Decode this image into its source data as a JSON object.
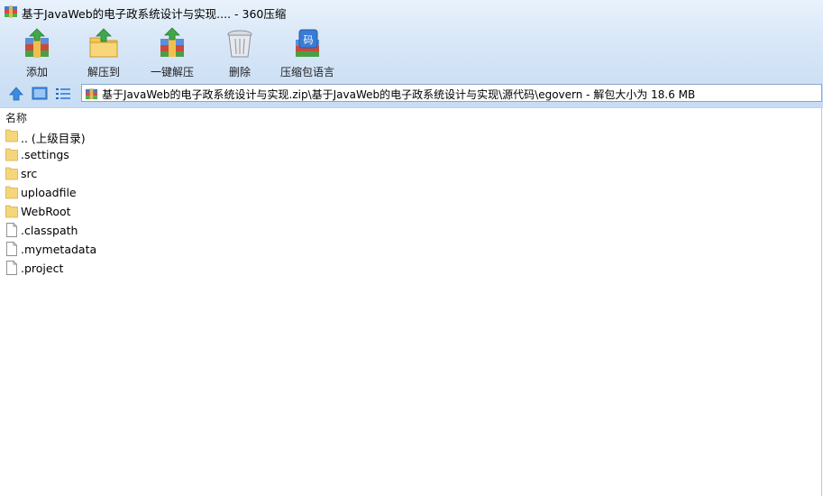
{
  "window": {
    "title": "基于JavaWeb的电子政系统设计与实现.... - 360压缩"
  },
  "toolbar": {
    "buttons": [
      {
        "label": "添加",
        "icon": "add-archive-icon"
      },
      {
        "label": "解压到",
        "icon": "extract-to-icon"
      },
      {
        "label": "一键解压",
        "icon": "one-click-extract-icon"
      },
      {
        "label": "删除",
        "icon": "delete-trash-icon"
      },
      {
        "label": "压缩包语言",
        "icon": "archive-language-icon"
      }
    ]
  },
  "navbar": {
    "address": "基于JavaWeb的电子政系统设计与实现.zip\\基于JavaWeb的电子政系统设计与实现\\源代码\\egovern - 解包大小为 18.6 MB",
    "icons": [
      "up-arrow-icon",
      "view-thumbnail-icon",
      "view-list-icon"
    ]
  },
  "list": {
    "column_name": "名称",
    "items": [
      {
        "name": ".. (上级目录)",
        "type": "folder"
      },
      {
        "name": ".settings",
        "type": "folder"
      },
      {
        "name": "src",
        "type": "folder"
      },
      {
        "name": "uploadfile",
        "type": "folder"
      },
      {
        "name": "WebRoot",
        "type": "folder"
      },
      {
        "name": ".classpath",
        "type": "file"
      },
      {
        "name": ".mymetadata",
        "type": "file"
      },
      {
        "name": ".project",
        "type": "file"
      }
    ]
  },
  "colors": {
    "chrome_top": "#e9f2fc",
    "chrome_bottom": "#c7dcf3",
    "folder": "#f5d67a",
    "address_border": "#8aa5c8"
  }
}
